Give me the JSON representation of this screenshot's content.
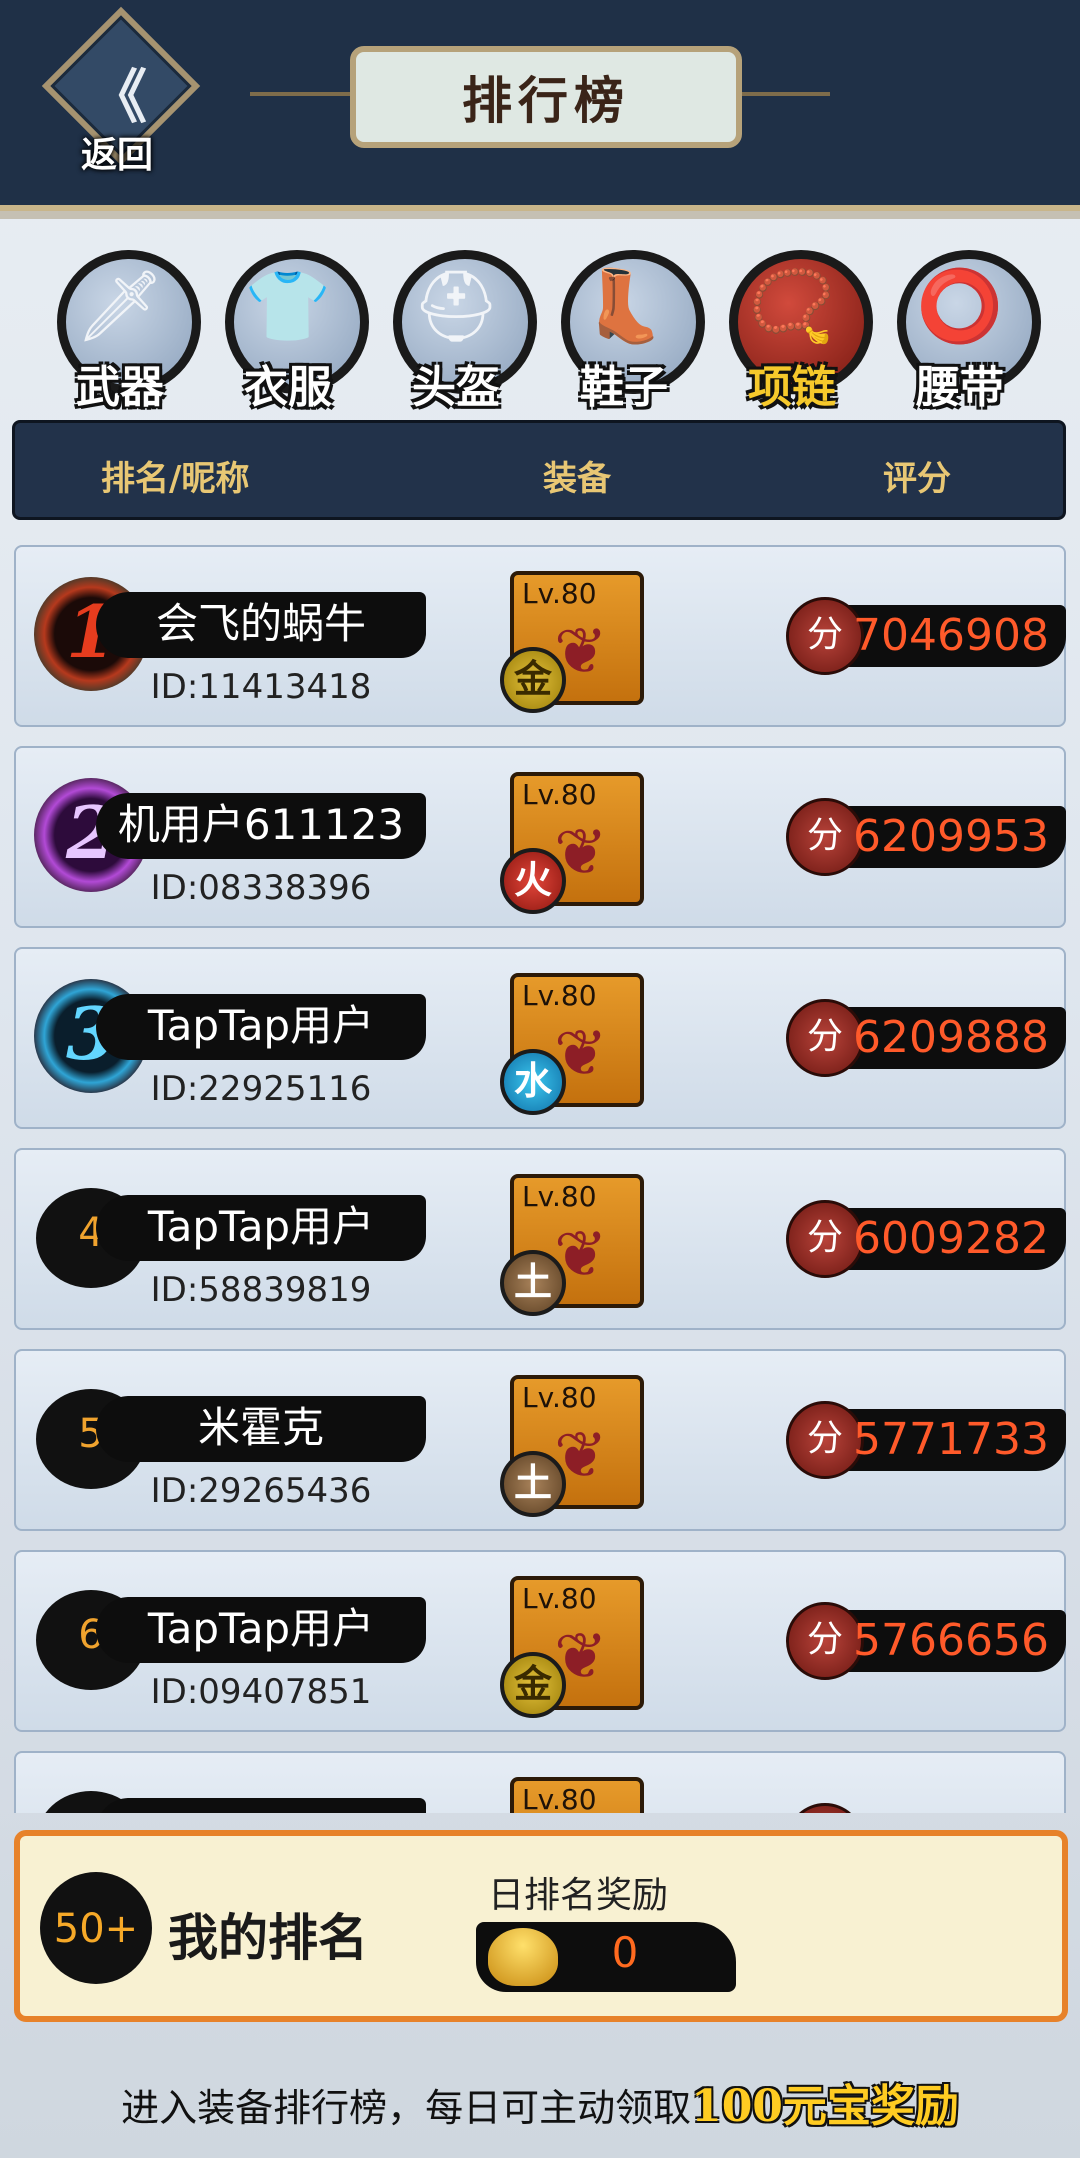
{
  "header": {
    "back_label": "返回",
    "back_glyph": "《",
    "title": "排行榜"
  },
  "tabs": [
    {
      "label": "武器",
      "icon": "sword-icon",
      "glyph": "🗡",
      "active": false
    },
    {
      "label": "衣服",
      "icon": "armor-icon",
      "glyph": "👕",
      "active": false
    },
    {
      "label": "头盔",
      "icon": "helmet-icon",
      "glyph": "⛑",
      "active": false
    },
    {
      "label": "鞋子",
      "icon": "boot-icon",
      "glyph": "👢",
      "active": false
    },
    {
      "label": "项链",
      "icon": "necklace-icon",
      "glyph": "📿",
      "active": true
    },
    {
      "label": "腰带",
      "icon": "belt-icon",
      "glyph": "⭕",
      "active": false
    }
  ],
  "table_header": {
    "rank_name": "排名/昵称",
    "equipment": "装备",
    "score": "评分"
  },
  "rows": [
    {
      "rank": "1",
      "name": "会飞的蜗牛",
      "id": "ID:11413418",
      "level": "Lv.80",
      "element": "金",
      "score_icon": "分",
      "score": "7046908"
    },
    {
      "rank": "2",
      "name": "机用户611123",
      "id": "ID:08338396",
      "level": "Lv.80",
      "element": "火",
      "score_icon": "分",
      "score": "6209953"
    },
    {
      "rank": "3",
      "name": "TapTap用户",
      "id": "ID:22925116",
      "level": "Lv.80",
      "element": "水",
      "score_icon": "分",
      "score": "6209888"
    },
    {
      "rank": "4",
      "name": "TapTap用户",
      "id": "ID:58839819",
      "level": "Lv.80",
      "element": "土",
      "score_icon": "分",
      "score": "6009282"
    },
    {
      "rank": "5",
      "name": "米霍克",
      "id": "ID:29265436",
      "level": "Lv.80",
      "element": "土",
      "score_icon": "分",
      "score": "5771733"
    },
    {
      "rank": "6",
      "name": "TapTap用户",
      "id": "ID:09407851",
      "level": "Lv.80",
      "element": "金",
      "score_icon": "分",
      "score": "5766656"
    },
    {
      "rank": "",
      "name": "",
      "id": "",
      "level": "Lv.80",
      "element": "",
      "score_icon": "",
      "score": ""
    }
  ],
  "my_rank": {
    "rank": "50+",
    "title": "我的排名",
    "reward_title": "日排名奖励",
    "reward_value": "0"
  },
  "footer": {
    "text": "进入装备排行榜，每日可主动领取",
    "highlight": "100元宝奖励"
  },
  "colors": {
    "topbar": "#1f3047",
    "active_tab_label": "#f6c92b",
    "score_text": "#ff5a2a",
    "my_rank_border": "#e7822a"
  }
}
